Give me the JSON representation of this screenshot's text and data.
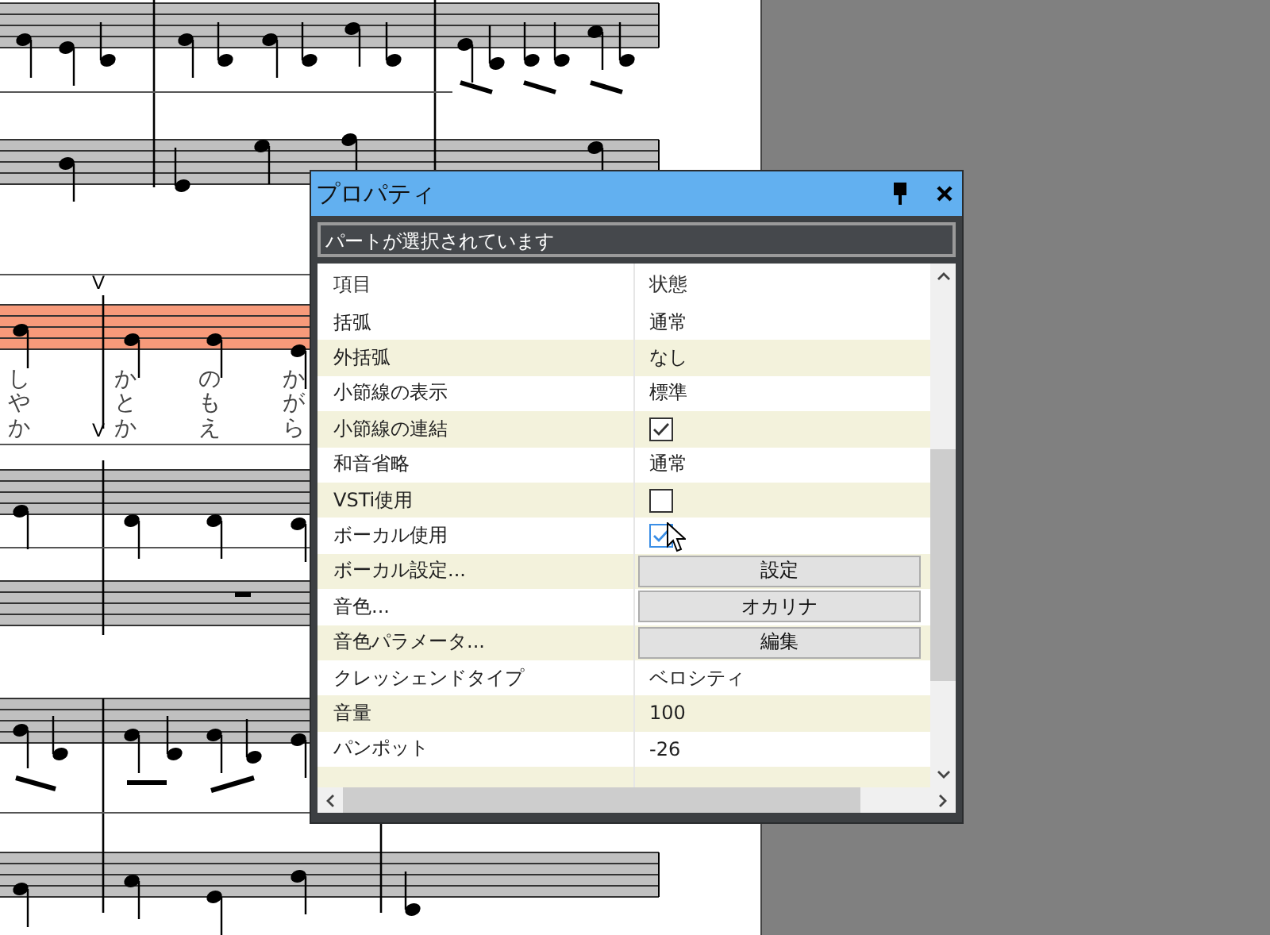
{
  "score": {
    "lyrics": [
      {
        "text": "しやか"
      },
      {
        "text": "かとか"
      },
      {
        "text": "のもえ"
      },
      {
        "text": "かがら"
      }
    ],
    "breath_marks": [
      "V",
      "V"
    ]
  },
  "dialog": {
    "title": "プロパティ",
    "status": "パートが選択されています",
    "columns": [
      "項目",
      "状態"
    ],
    "rows": [
      {
        "kind": "text",
        "label": "括弧",
        "value": "通常"
      },
      {
        "kind": "text",
        "label": "外括弧",
        "value": "なし"
      },
      {
        "kind": "text",
        "label": "小節線の表示",
        "value": "標準"
      },
      {
        "kind": "checkbox",
        "label": "小節線の連結",
        "checked": true
      },
      {
        "kind": "text",
        "label": "和音省略",
        "value": "通常"
      },
      {
        "kind": "checkbox",
        "label": "VSTi使用",
        "checked": false
      },
      {
        "kind": "checkbox",
        "label": "ボーカル使用",
        "checked": true,
        "hovered": true
      },
      {
        "kind": "button",
        "label": "ボーカル設定...",
        "value": "設定"
      },
      {
        "kind": "button",
        "label": "音色...",
        "value": "オカリナ"
      },
      {
        "kind": "button",
        "label": "音色パラメータ...",
        "value": "編集"
      },
      {
        "kind": "text",
        "label": "クレッシェンドタイプ",
        "value": "ベロシティ"
      },
      {
        "kind": "text",
        "label": "音量",
        "value": "100"
      },
      {
        "kind": "text",
        "label": "パンポット",
        "value": "-26"
      },
      {
        "kind": "empty"
      }
    ]
  }
}
